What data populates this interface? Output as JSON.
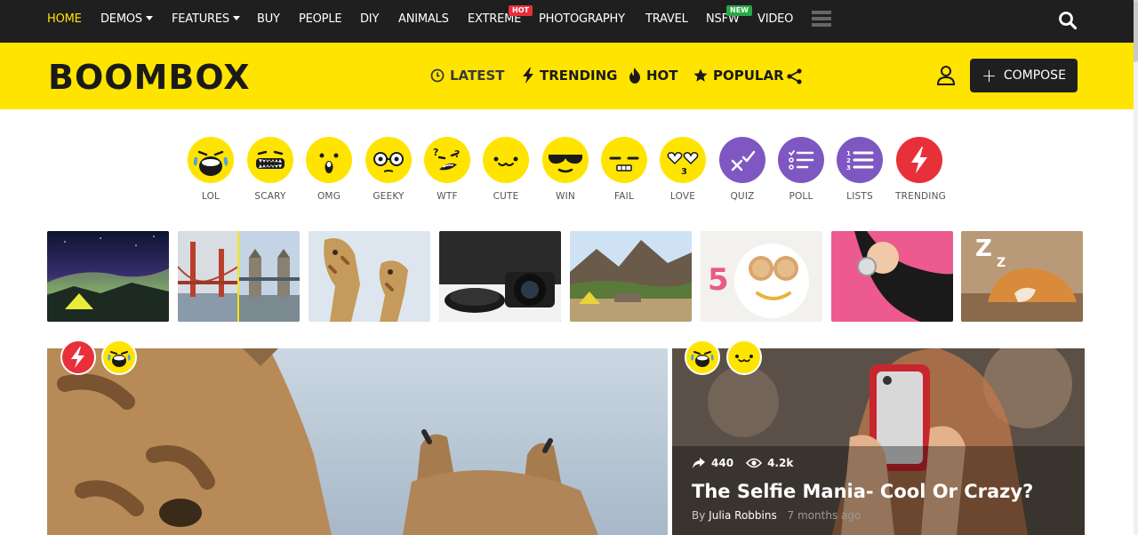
{
  "topnav": {
    "items": [
      {
        "label": "HOME",
        "active": true
      },
      {
        "label": "DEMOS",
        "dropdown": true
      },
      {
        "label": "FEATURES",
        "dropdown": true
      },
      {
        "label": "BUY"
      },
      {
        "label": "PEOPLE"
      },
      {
        "label": "DIY"
      },
      {
        "label": "ANIMALS"
      },
      {
        "label": "EXTREME",
        "badge": "HOT"
      },
      {
        "label": "PHOTOGRAPHY"
      },
      {
        "label": "TRAVEL"
      },
      {
        "label": "NSFW",
        "badge": "NEW"
      },
      {
        "label": "VIDEO"
      }
    ],
    "icons": [
      "hamburger-menu-icon",
      "search-icon"
    ]
  },
  "header": {
    "logo": "BOOMBOX",
    "nav": [
      {
        "label": "LATEST",
        "icon": "clock-icon"
      },
      {
        "label": "TRENDING",
        "icon": "lightning-icon"
      },
      {
        "label": "HOT",
        "icon": "fire-icon"
      },
      {
        "label": "POPULAR",
        "icon": "star-icon"
      }
    ],
    "compose_label": "COMPOSE"
  },
  "reactions": [
    {
      "label": "LOL"
    },
    {
      "label": "SCARY"
    },
    {
      "label": "OMG"
    },
    {
      "label": "GEEKY"
    },
    {
      "label": "WTF"
    },
    {
      "label": "CUTE"
    },
    {
      "label": "WIN"
    },
    {
      "label": "FAIL"
    },
    {
      "label": "LOVE"
    },
    {
      "label": "QUIZ"
    },
    {
      "label": "POLL"
    },
    {
      "label": "LISTS"
    },
    {
      "label": "TRENDING"
    }
  ],
  "featured": {
    "shares": "440",
    "views": "4.2k",
    "title": "The Selfie Mania- Cool Or Crazy?",
    "by": "By",
    "author": "Julia Robbins",
    "ago": "7 months ago"
  },
  "colors": {
    "brand_yellow": "#ffe400",
    "dark": "#1f1f1f",
    "purple": "#7e57c2",
    "red": "#e8303b",
    "hot_badge": "#e8303b",
    "new_badge": "#27a745"
  }
}
